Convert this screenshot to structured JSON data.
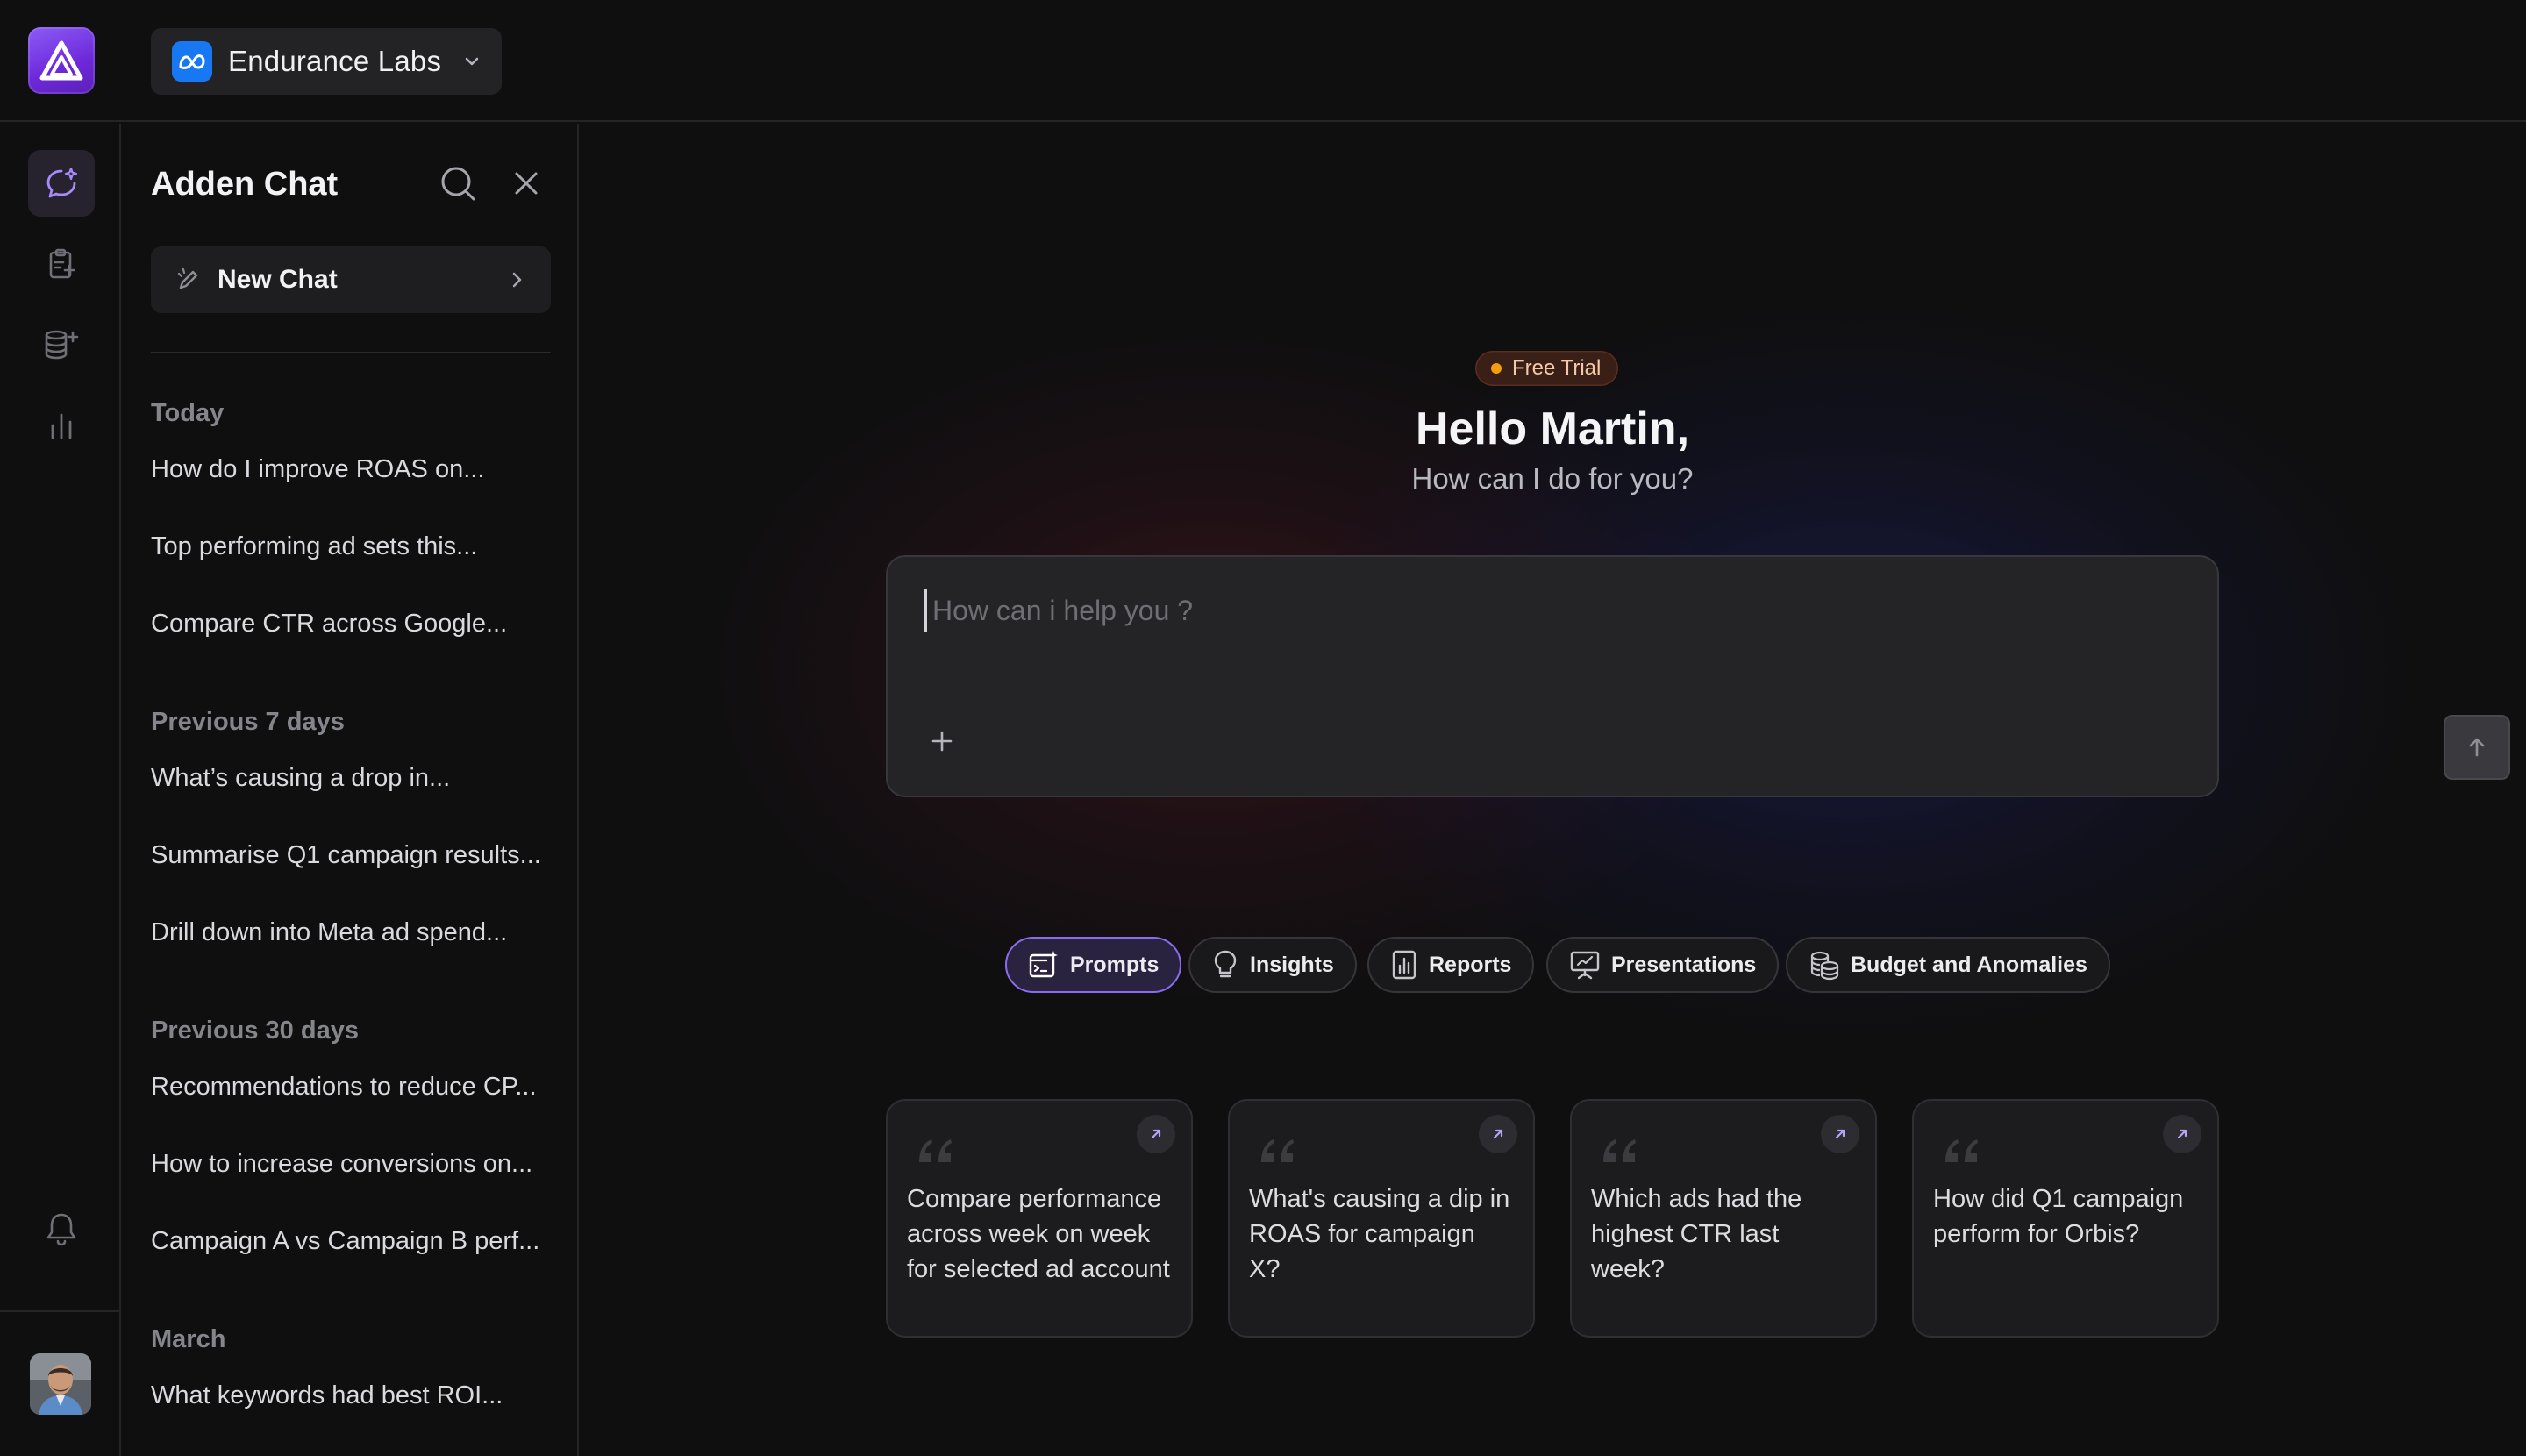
{
  "workspace": {
    "name": "Endurance Labs"
  },
  "history": {
    "title": "Adden Chat",
    "new_chat_label": "New Chat",
    "sections": [
      {
        "label": "Today",
        "items": [
          "How do I improve ROAS on...",
          "Top performing ad sets this...",
          "Compare CTR across Google..."
        ]
      },
      {
        "label": "Previous 7 days",
        "items": [
          "What’s causing a drop in...",
          "Summarise Q1 campaign results...",
          "Drill down into Meta ad spend..."
        ]
      },
      {
        "label": "Previous 30 days",
        "items": [
          "Recommendations to reduce CP...",
          "How to increase conversions on...",
          "Campaign A vs Campaign B perf..."
        ]
      },
      {
        "label": "March",
        "items": [
          "What keywords had best ROI..."
        ]
      }
    ]
  },
  "main": {
    "badge": "Free Trial",
    "greeting": "Hello Martin,",
    "subgreeting": "How can I do for you?",
    "composer_placeholder": "How can i help you ?",
    "pills": [
      {
        "label": "Prompts",
        "icon": "prompts-icon",
        "active": true
      },
      {
        "label": "Insights",
        "icon": "lightbulb-icon",
        "active": false
      },
      {
        "label": "Reports",
        "icon": "report-chart-icon",
        "active": false
      },
      {
        "label": "Presentations",
        "icon": "presentation-icon",
        "active": false
      },
      {
        "label": "Budget and Anomalies",
        "icon": "coins-icon",
        "active": false
      }
    ],
    "cards": [
      {
        "text": "Compare performance across week on week for selected ad account"
      },
      {
        "text": "What's causing a dip in ROAS for campaign X?"
      },
      {
        "text": "Which ads had the highest CTR last week?"
      },
      {
        "text": "How did Q1 campaign perform for Orbis?"
      }
    ]
  },
  "colors": {
    "accent": "#8b5cf6",
    "badge_dot": "#f59e0b",
    "meta_blue": "#1877f2"
  }
}
